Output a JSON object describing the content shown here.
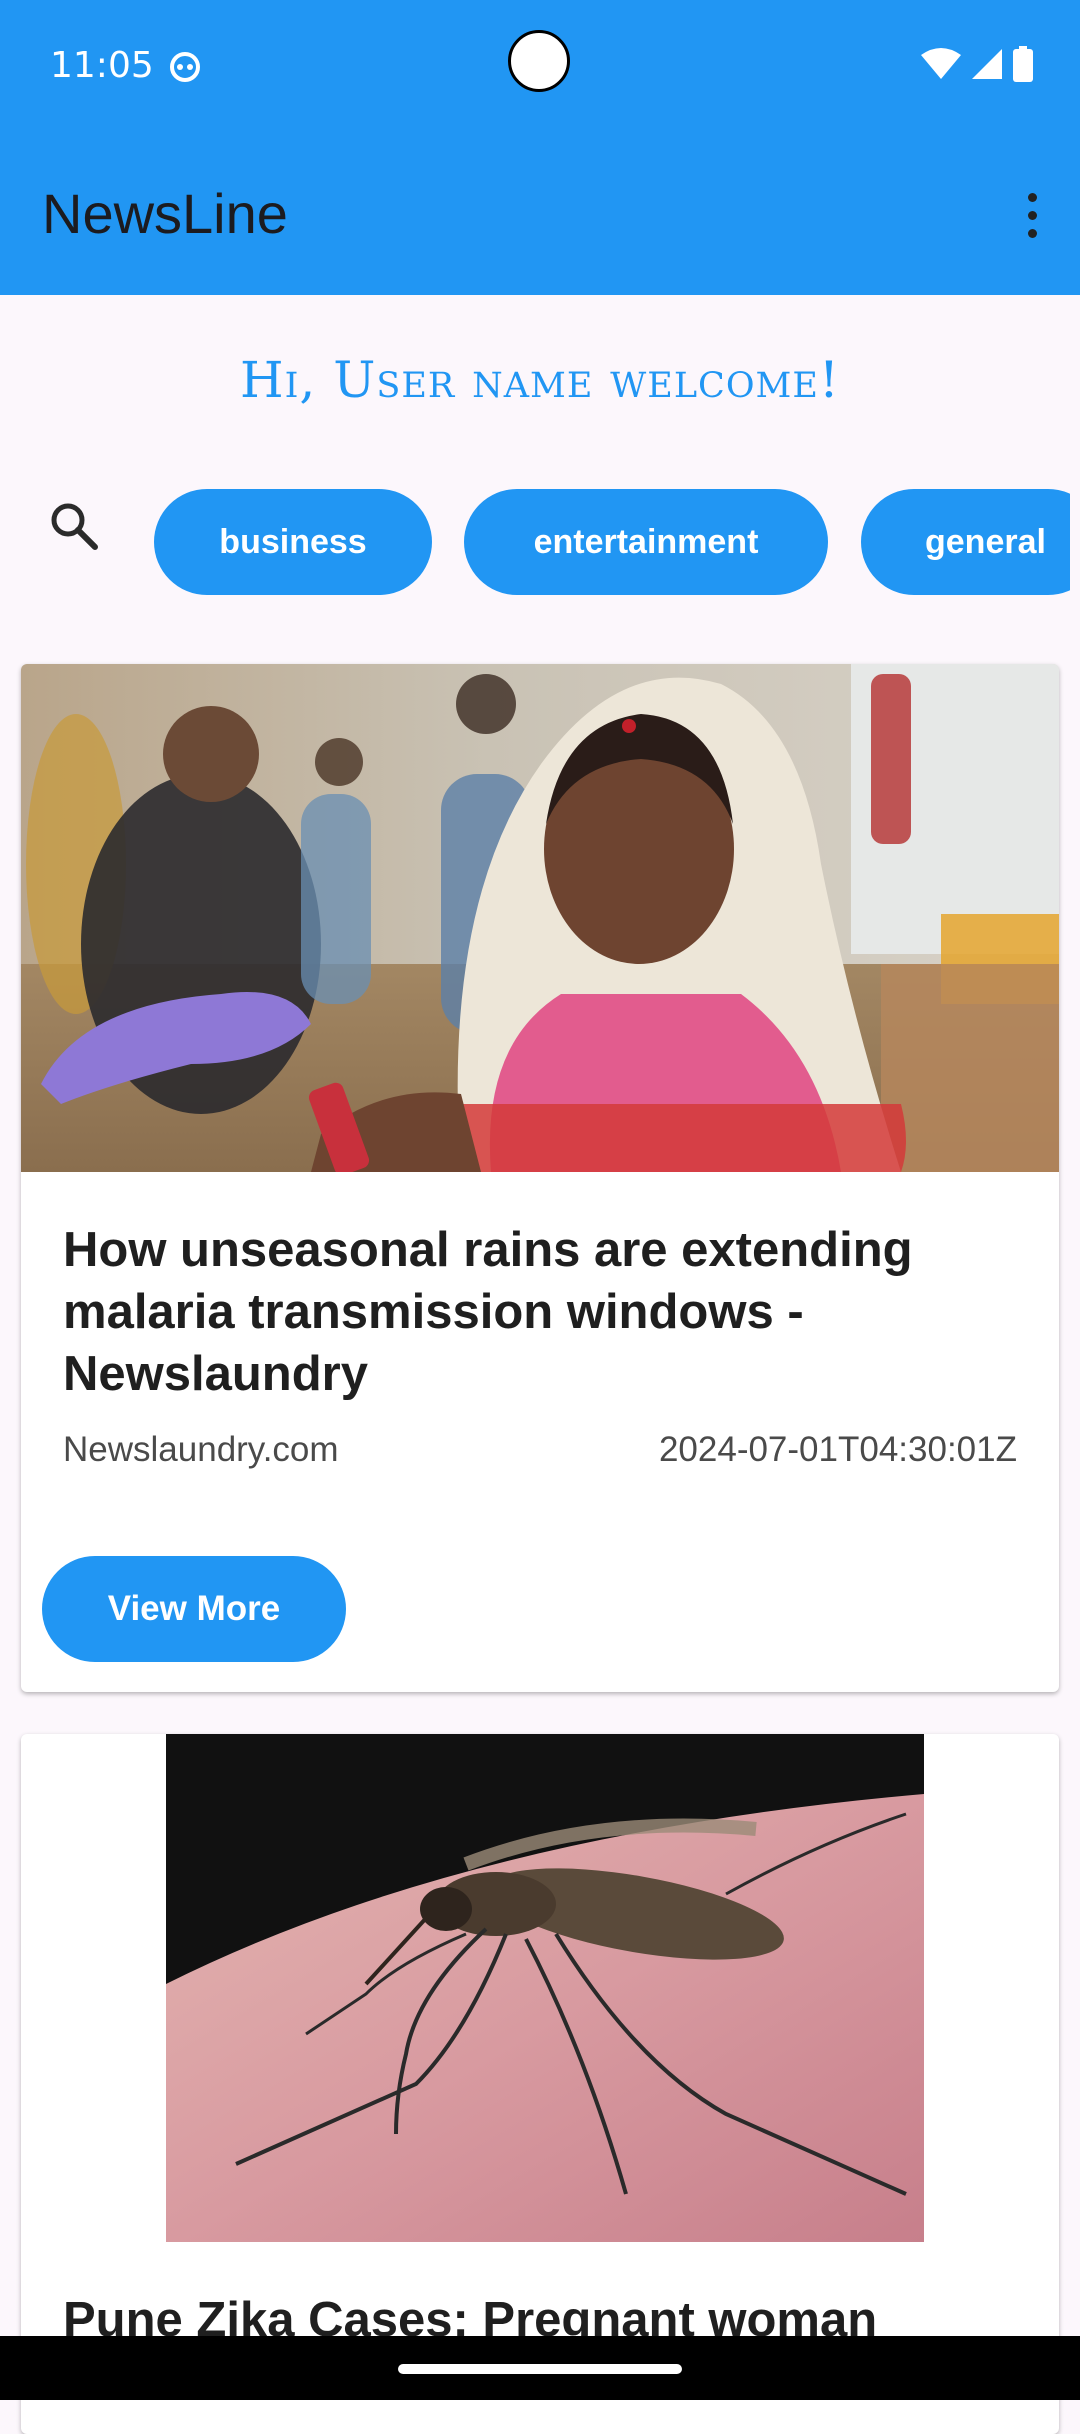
{
  "status_bar": {
    "time": "11:05",
    "icons": [
      "app-notification-icon",
      "wifi-icon",
      "signal-icon",
      "battery-icon"
    ]
  },
  "app_bar": {
    "title": "NewsLine",
    "menu_icon": "more-vert-icon"
  },
  "welcome": {
    "text": "Hi, User name welcome!"
  },
  "search": {
    "icon": "search-icon"
  },
  "categories": [
    "business",
    "entertainment",
    "general"
  ],
  "articles": [
    {
      "title": "How unseasonal rains are extending malaria transmission windows - Newslaundry",
      "source": "Newslaundry.com",
      "published_at": "2024-07-01T04:30:01Z",
      "button_label": "View More",
      "image": "woman-health-checkup-photo"
    },
    {
      "title": "Pune Zika Cases: Pregnant woman",
      "image": "mosquito-on-skin-photo"
    }
  ],
  "colors": {
    "primary": "#2196F3",
    "background": "#FCF7FC",
    "card": "#FFFFFF",
    "on_primary_button": "#FFFFFF"
  }
}
